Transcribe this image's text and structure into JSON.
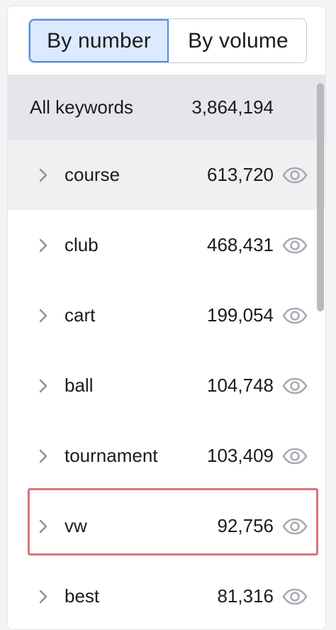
{
  "toggle": {
    "by_number": "By number",
    "by_volume": "By volume",
    "active": "by_number"
  },
  "summary": {
    "label": "All keywords",
    "count": "3,864,194"
  },
  "keywords": [
    {
      "label": "course",
      "count": "613,720"
    },
    {
      "label": "club",
      "count": "468,431"
    },
    {
      "label": "cart",
      "count": "199,054"
    },
    {
      "label": "ball",
      "count": "104,748"
    },
    {
      "label": "tournament",
      "count": "103,409"
    },
    {
      "label": "vw",
      "count": "92,756"
    },
    {
      "label": "best",
      "count": "81,316"
    }
  ],
  "icons": {
    "expand": "chevron-right-icon",
    "view": "eye-icon"
  },
  "colors": {
    "active_segment_bg": "#dce9ff",
    "active_segment_border": "#4d8de8",
    "header_row_bg": "#e6e6ea",
    "hover_row_bg": "#f0f0f3",
    "highlight_border": "#d9747a",
    "icon_gray": "#a9abb3"
  }
}
